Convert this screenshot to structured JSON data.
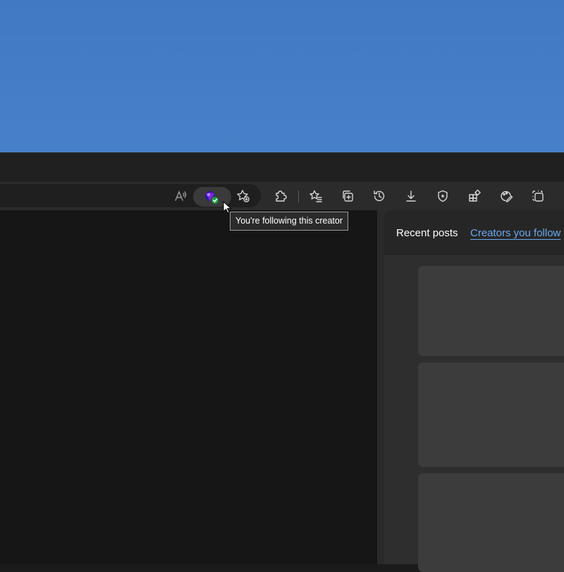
{
  "colors": {
    "desktop": "#4479c4",
    "browser_frame": "#202020",
    "toolbar": "#2b2b2b",
    "content": "#161616",
    "panel": "#2e2e2e",
    "card": "#3c3c3c",
    "accent": "#6aa8f0",
    "follow_badge": "#1aa34a"
  },
  "address_bar": {
    "icons": [
      "read-aloud-icon",
      "creator-following-icon",
      "add-favorite-icon"
    ]
  },
  "toolbar": {
    "icons": [
      "extensions-icon",
      "favorites-icon",
      "collections-icon",
      "history-icon",
      "downloads-icon",
      "browser-essentials-icon",
      "apps-icon",
      "copilot-icon",
      "screenshot-icon"
    ]
  },
  "tooltip": {
    "text": "You're following this creator"
  },
  "side_panel": {
    "tabs": [
      {
        "label": "Recent posts",
        "active": false
      },
      {
        "label": "Creators you follow",
        "active": true
      }
    ]
  }
}
